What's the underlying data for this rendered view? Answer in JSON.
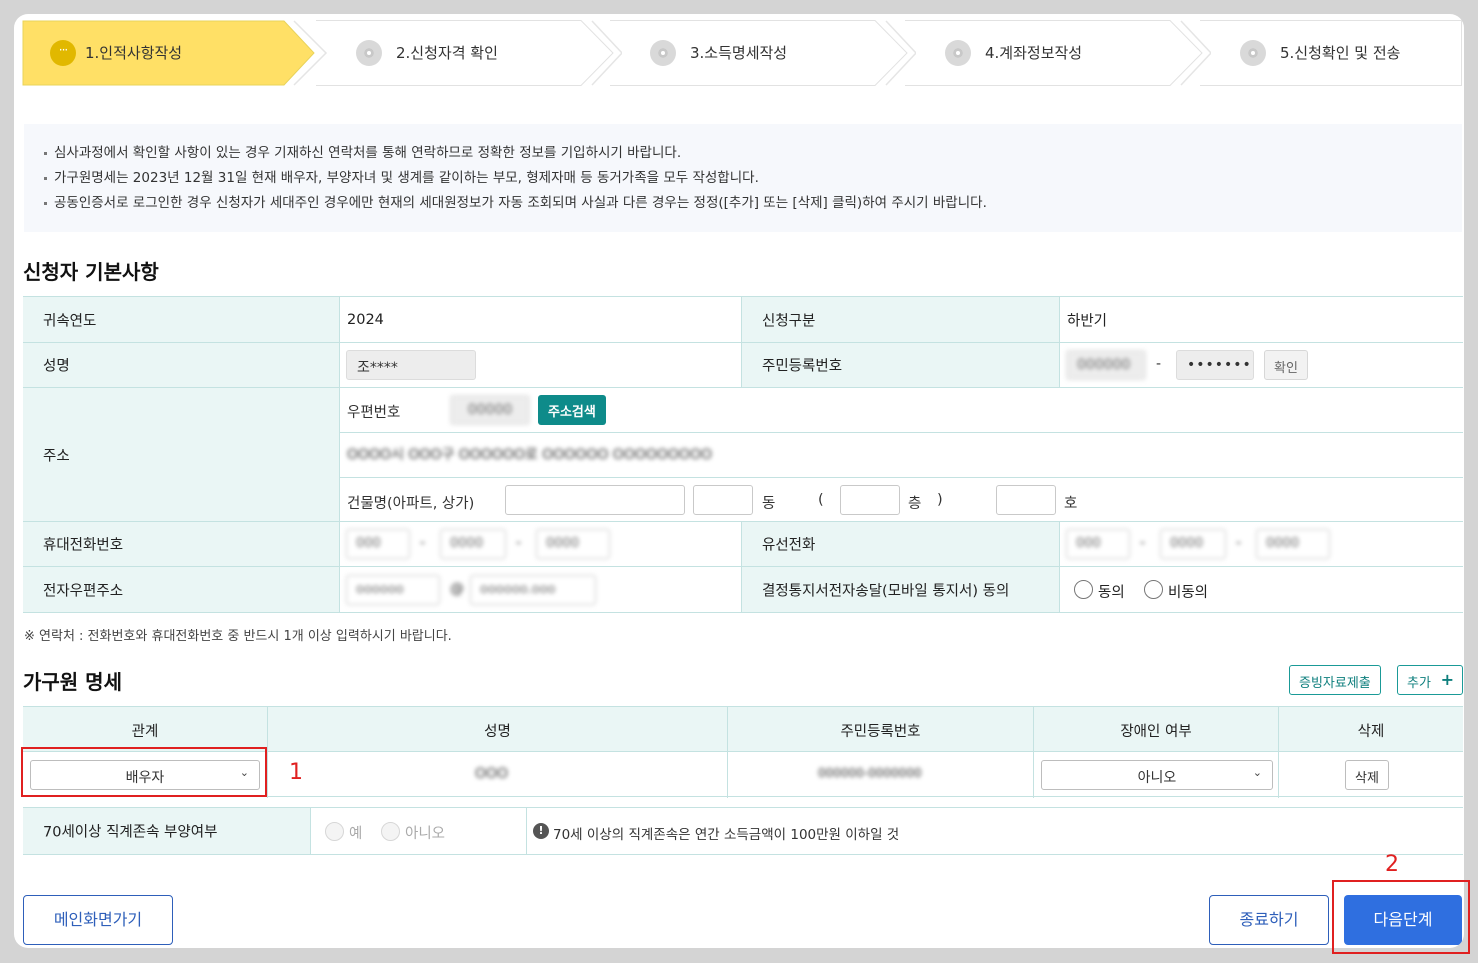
{
  "steps": [
    {
      "label": "1.인적사항작성",
      "active": true
    },
    {
      "label": "2.신청자격 확인",
      "active": false
    },
    {
      "label": "3.소득명세작성",
      "active": false
    },
    {
      "label": "4.계좌정보작성",
      "active": false
    },
    {
      "label": "5.신청확인 및 전송",
      "active": false
    }
  ],
  "notices": [
    "심사과정에서 확인할 사항이 있는 경우 기재하신 연락처를 통해 연락하므로 정확한 정보를 기입하시기 바랍니다.",
    "가구원명세는 2023년 12월 31일 현재 배우자, 부양자녀 및 생계를 같이하는 부모, 형제자매 등 동거가족을 모두 작성합니다.",
    "공동인증서로 로그인한 경우 신청자가 세대주인 경우에만 현재의 세대원정보가 자동 조회되며 사실과 다른 경우는 정정([추가] 또는 [삭제] 클릭)하여 주시기 바랍니다."
  ],
  "basic": {
    "title": "신청자 기본사항",
    "year_label": "귀속연도",
    "year_value": "2024",
    "type_label": "신청구분",
    "type_value": "하반기",
    "name_label": "성명",
    "name_value": "조****",
    "rrn_label": "주민등록번호",
    "rrn_front": "000000",
    "rrn_dash": "-",
    "rrn_back": "•••••••",
    "rrn_confirm": "확인",
    "address_label": "주소",
    "zip_label": "우편번호",
    "zip_value": "00000",
    "addr_search": "주소검색",
    "addr_value": "OOOO시 OOO구 OOOOOO로 OOOOOO OOOOOOOOO",
    "building_label": "건물명(아파트, 상가)",
    "dong": "동",
    "paren_open": "(",
    "floor": "층",
    "paren_close": ")",
    "ho": "호",
    "mobile_label": "휴대전화번호",
    "mobile": [
      "000",
      "0000",
      "0000"
    ],
    "phone_label": "유선전화",
    "phone": [
      "000",
      "0000",
      "0000"
    ],
    "phone_dash": "-",
    "email_label": "전자우편주소",
    "email_id": "oooooo",
    "email_at": "@",
    "email_domain": "oooooo.ooo",
    "consent_label": "결정통지서전자송달(모바일 통지서) 동의",
    "consent_yes": "동의",
    "consent_no": "비동의"
  },
  "note": "※ 연락처 : 전화번호와 휴대전화번호 중 반드시 1개 이상 입력하시기 바랍니다.",
  "family": {
    "title": "가구원 명세",
    "evidence_button": "증빙자료제출",
    "add_button": "추가",
    "add_icon": "plus-icon",
    "headers": [
      "관계",
      "성명",
      "주민등록번호",
      "장애인 여부",
      "삭제"
    ],
    "rows": [
      {
        "relation": "배우자",
        "name": "OOO",
        "rrn": "000000-0000000",
        "disabled": "아니오",
        "delete": "삭제"
      }
    ],
    "age_label": "70세이상 직계존속 부양여부",
    "age_yes": "예",
    "age_no": "아니오",
    "age_info": "70세 이상의 직계존속은 연간 소득금액이 100만원 이하일 것"
  },
  "annotations": {
    "mark1": "1",
    "mark2": "2",
    "color": "#e02020"
  },
  "footer": {
    "main_button": "메인화면가기",
    "exit_button": "종료하기",
    "next_button": "다음단계"
  },
  "colors": {
    "accent": "#0e8b8a",
    "step_active": "#ffe066",
    "primary": "#2f6fe0",
    "table_head": "#eaf6f5"
  }
}
